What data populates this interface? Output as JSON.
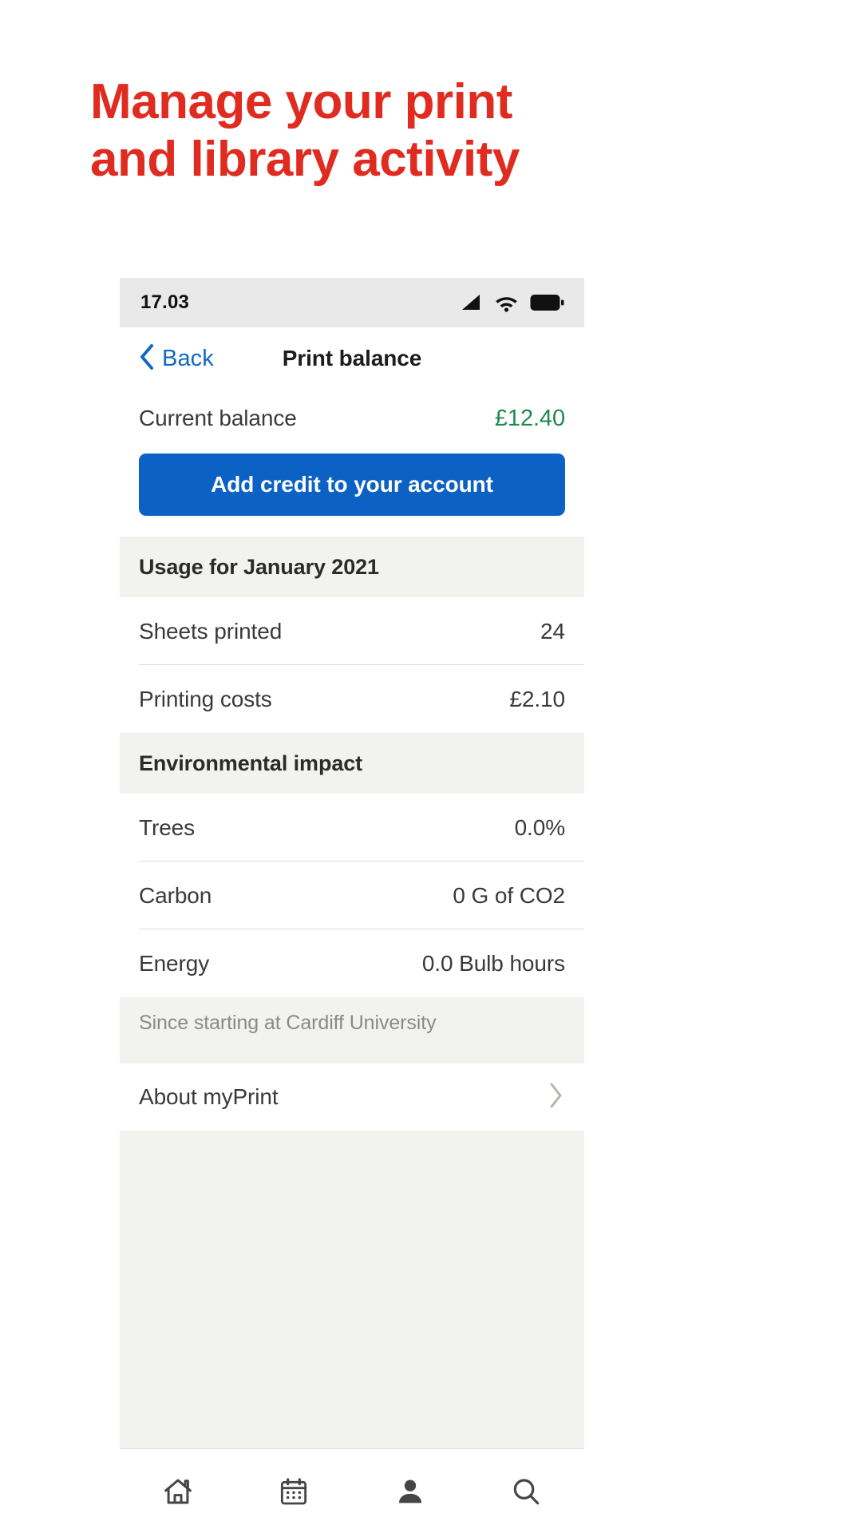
{
  "promo": {
    "headline_line1": "Manage your print",
    "headline_line2": "and library activity",
    "headline_color": "#e02b20"
  },
  "status_bar": {
    "time": "17.03",
    "icons": [
      "signal-icon",
      "wifi-icon",
      "battery-icon"
    ]
  },
  "nav": {
    "back_label": "Back",
    "title": "Print balance"
  },
  "balance": {
    "label": "Current balance",
    "amount": "£12.40",
    "amount_color": "#1d8a4e",
    "cta_label": "Add credit to your account",
    "cta_color": "#0b62c4"
  },
  "usage": {
    "header": "Usage for January 2021",
    "rows": [
      {
        "label": "Sheets printed",
        "value": "24"
      },
      {
        "label": "Printing costs",
        "value": "£2.10"
      }
    ]
  },
  "environment": {
    "header": "Environmental impact",
    "rows": [
      {
        "label": "Trees",
        "value": "0.0%"
      },
      {
        "label": "Carbon",
        "value": "0 G of CO2"
      },
      {
        "label": "Energy",
        "value": "0.0 Bulb hours"
      }
    ],
    "footnote": "Since starting at Cardiff University"
  },
  "about": {
    "label": "About myPrint",
    "chevron": "chevron-right-icon"
  },
  "tab_bar": {
    "items": [
      {
        "icon": "home-icon"
      },
      {
        "icon": "calendar-icon"
      },
      {
        "icon": "person-icon"
      },
      {
        "icon": "search-icon"
      }
    ]
  }
}
